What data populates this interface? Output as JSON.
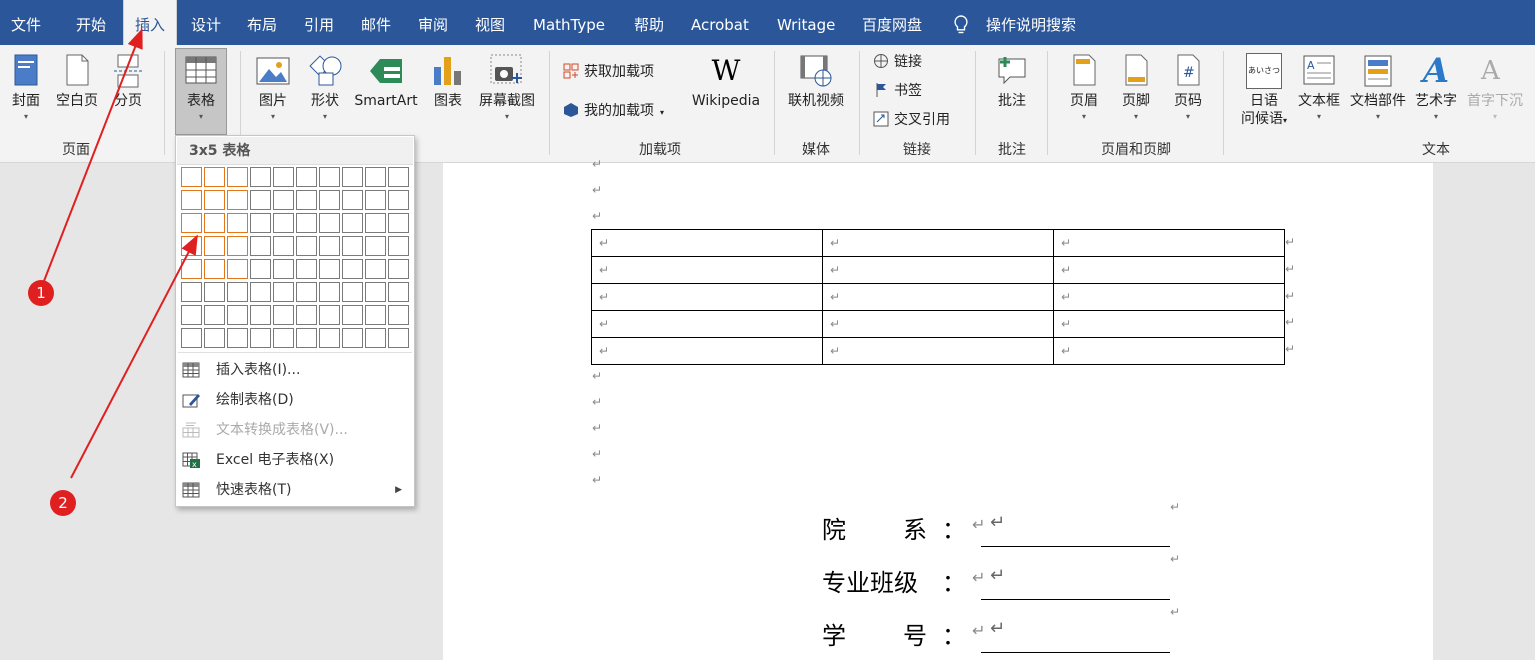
{
  "menu_tabs": [
    "文件",
    "开始",
    "插入",
    "设计",
    "布局",
    "引用",
    "邮件",
    "审阅",
    "视图",
    "MathType",
    "帮助",
    "Acrobat",
    "Writage",
    "百度网盘",
    "操作说明搜索"
  ],
  "ribbon": {
    "page_group": {
      "cover": "封面",
      "blank_page": "空白页",
      "page_break": "分页",
      "label": "页面"
    },
    "table_group": {
      "table": "表格",
      "label": ""
    },
    "illustrations": {
      "picture": "图片",
      "shapes": "形状",
      "smartart": "SmartArt",
      "chart": "图表",
      "screenshot": "屏幕截图"
    },
    "addins": {
      "get_addins": "获取加载项",
      "my_addins": "我的加载项",
      "wikipedia": "Wikipedia",
      "wiki_glyph": "W",
      "label": "加载项"
    },
    "media": {
      "online_video": "联机视频",
      "label": "媒体"
    },
    "links": {
      "link": "链接",
      "bookmark": "书签",
      "cross_ref": "交叉引用",
      "label": "链接"
    },
    "comments": {
      "comment": "批注",
      "label": "批注"
    },
    "header_footer": {
      "header": "页眉",
      "footer": "页脚",
      "page_number": "页码",
      "label": "页眉和页脚"
    },
    "text": {
      "japanese_1": "日语",
      "japanese_2": "问候语",
      "textbox": "文本框",
      "quick_parts": "文档部件",
      "wordart": "艺术字",
      "dropcap": "首字下沉",
      "label": "文本",
      "jp_icon_text": "あいさつ"
    }
  },
  "dropdown": {
    "header": "3x5 表格",
    "grid_cols": 10,
    "grid_rows": 8,
    "selected_cols": 3,
    "selected_rows": 5,
    "items": [
      {
        "label": "插入表格(I)...",
        "disabled": false
      },
      {
        "label": "绘制表格(D)",
        "disabled": false
      },
      {
        "label": "文本转换成表格(V)...",
        "disabled": true
      },
      {
        "label": "Excel 电子表格(X)",
        "disabled": false
      },
      {
        "label": "快速表格(T)",
        "disabled": false
      }
    ]
  },
  "document": {
    "para_mark": "↵",
    "table": {
      "rows": 5,
      "cols": 3
    },
    "form_fields": [
      {
        "c1": "院",
        "c2": "系",
        "colon": "："
      },
      {
        "label": "专业班级",
        "colon": "："
      },
      {
        "c1": "学",
        "c2": "号",
        "colon": "："
      }
    ]
  },
  "annotations": [
    "1",
    "2"
  ],
  "colors": {
    "accent": "#2b579a",
    "grid_highlight": "#e3761b",
    "annotation": "#e02020"
  }
}
